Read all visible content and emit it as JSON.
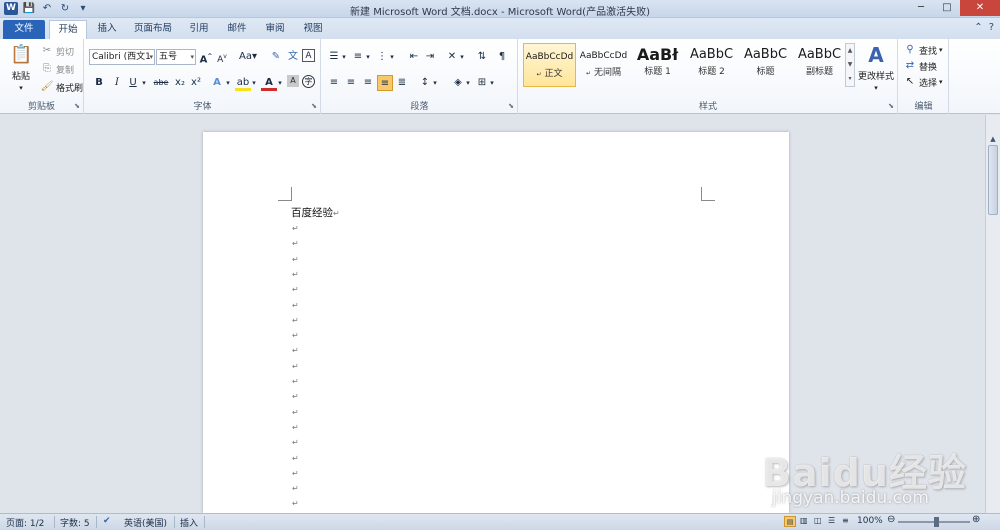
{
  "window": {
    "title": "新建 Microsoft Word 文档.docx - Microsoft Word(产品激活失败)",
    "controls": [
      "─",
      "□",
      "✕"
    ]
  },
  "qat": {
    "logo": "W",
    "save": "💾",
    "undo": "↶",
    "redo": "↻",
    "customize": "▾"
  },
  "tabs": {
    "file": "文件",
    "items": [
      "开始",
      "插入",
      "页面布局",
      "引用",
      "邮件",
      "审阅",
      "视图"
    ]
  },
  "ribbon": {
    "clipboard": {
      "label": "剪贴板",
      "paste": "粘贴",
      "cut": "剪切",
      "copy": "复制",
      "format_painter": "格式刷"
    },
    "font": {
      "label": "字体",
      "font_name": "Calibri (西文1",
      "font_size": "五号",
      "bold": "B",
      "italic": "I",
      "underline": "U",
      "strikethrough": "abe",
      "subscript": "x₂",
      "superscript": "x²",
      "grow": "A",
      "shrink": "A",
      "change_case": "Aa",
      "clear": "A"
    },
    "paragraph": {
      "label": "段落"
    },
    "styles": {
      "label": "样式",
      "items": [
        {
          "preview": "AaBbCcDd",
          "name": "正文",
          "selected": true
        },
        {
          "preview": "AaBbCcDd",
          "name": "无间隔",
          "selected": false
        },
        {
          "preview": "AaBł",
          "name": "标题 1",
          "selected": false
        },
        {
          "preview": "AaBbC",
          "name": "标题 2",
          "selected": false
        },
        {
          "preview": "AaBbC",
          "name": "标题",
          "selected": false
        },
        {
          "preview": "AaBbC",
          "name": "副标题",
          "selected": false
        }
      ],
      "change_styles": "更改样式"
    },
    "editing": {
      "label": "编辑",
      "find": "查找",
      "replace": "替换",
      "select": "选择"
    }
  },
  "document": {
    "first_line": "百度经验",
    "paragraph_mark": "↵",
    "empty_paragraph_count": 20
  },
  "watermark": {
    "brand": "Baidu经验",
    "url": "jingyan.baidu.com"
  },
  "status": {
    "page": "页面: 1/2",
    "words": "字数: 5",
    "language": "英语(美国)",
    "mode": "插入",
    "zoom": "100%"
  }
}
